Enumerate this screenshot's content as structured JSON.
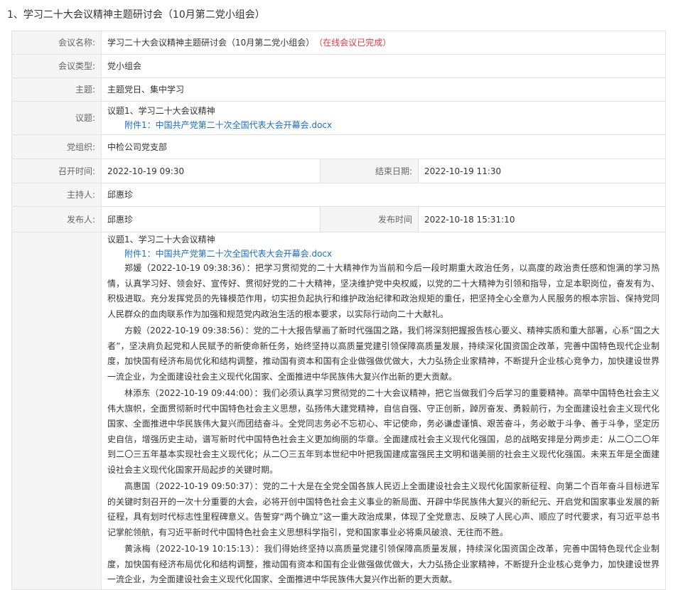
{
  "page": {
    "title": "1、学习二十大会议精神主题研讨会（10月第二党小组会）"
  },
  "fields": {
    "name_label": "会议名称:",
    "name_value": "学习二十大会议精神主题研讨会（10月第二党小组会）",
    "status": "（在线会议已完成）",
    "type_label": "会议类型:",
    "type_value": "党小组会",
    "theme_label": "主题:",
    "theme_value": "主题党日、集中学习",
    "topic_label": "议题:",
    "topic_value": "议题1、学习二十大会议精神",
    "attachment": "附件1：中国共产党第二十次全国代表大会开幕会.docx",
    "org_label": "党组织:",
    "org_value": "中检公司党支部",
    "start_label": "召开时间:",
    "start_value": "2022-10-19 09:30",
    "end_label": "结束日期:",
    "end_value": "2022-10-19 11:30",
    "host_label": "主持人:",
    "host_value": "邱惠珍",
    "publisher_label": "发布人:",
    "publisher_value": "邱惠珍",
    "publish_time_label": "发布时间",
    "publish_time_value": "2022-10-18 15:31:10"
  },
  "content": {
    "topic": "议题1、学习二十大会议精神",
    "attachment": "附件1：中国共产党第二十次全国代表大会开幕会.docx",
    "comments": [
      "郑媛（2022-10-19 09:38:36）：把学习贯彻党的二十大精神作为当前和今后一段时期重大政治任务，以高度的政治责任感和饱满的学习热情，认真学习好、领会好、宣传好、贯彻好党的二十大精神，坚决维护党中央权威，以党的二十大精神为引领和指导，立足本职岗位，奋发有为、积极进取。充分发挥党员的先锋模范作用，切实担负起执行和维护政治纪律和政治规矩的重任，把坚持全心全意为人民服务的根本宗旨、保持党同人民群众的血肉联系作为加强和规范党内政治生活的根本要求，以实际行动向二十大献礼。",
      "方毅（2022-10-19 09:38:56）：党的二十大报告擘画了新时代强国之路，我们将深刻把握报告核心要义、精神实质和重大部署，心系“国之大者”，坚决肩负起党和人民赋予的新使命新任务，始终坚持以高质量党建引领保障高质量发展，持续深化国资国企改革，完善中国特色现代企业制度，加快国有经济布局优化和结构调整，推动国有资本和国有企业做强做优做大，大力弘扬企业家精神，不断提升企业核心竞争力，加快建设世界一流企业，为全面建设社会主义现代化国家、全面推进中华民族伟大复兴作出新的更大贡献。",
      "林添东（2022-10-19 09:44:00）：我们必须认真学习贯彻党的二十大会议精神，把它当做我们今后学习的重要精神。高举中国特色社会主义伟大旗帜，全面贯彻新时代中国特色社会主义思想，弘扬伟大建党精神，自信自强、守正创新，踔厉奋发、勇毅前行，为全面建设社会主义现代化国家、全面推进中华民族伟大复兴而团结奋斗。全党同志务必不忘初心、牢记使命，务必谦虚谨慎、艰苦奋斗，务必敢于斗争、善于斗争，坚定历史自信，增强历史主动，谱写新时代中国特色社会主义更加绚丽的华章。全面建成社会主义现代化强国，总的战略安排是分两步走：从二〇二〇年到二〇三五年基本实现社会主义现代化；从二〇三五年到本世纪中叶把我国建成富强民主文明和谐美丽的社会主义现代化强国。未来五年是全面建设社会主义现代化国家开局起步的关键时期。",
      "高惠国（2022-10-19 09:50:37）：党的二十大是在全党全国各族人民迈上全面建设社会主义现代化国家新征程、向第二个百年奋斗目标进军的关键时刻召开的一次十分重要的大会，必将开创中国特色社会主义事业的新局面、开辟中华民族伟大复兴的新纪元、开启党和国家事业发展的新征程，具有划时代标志性里程碑意义。告誓穿“两个确立”这一重大政治成果，体现了全党意志、反映了人民心声、顺应了时代要求，有习近平总书记掌舵领航，有习近平新时代中国特色社会主义思想科学指引，党和国家事业必将乘风破浪、无往而不胜。",
      "黄泳梅（2022-10-19 10:15:13）：我们得始终坚持以高质量党建引领保障高质量发展，持续深化国资国企改革，完善中国特色现代企业制度，加快国有经济布局优化和结构调整，推动国有资本和国有企业做强做优做大，大力弘扬企业家精神，不断提升企业核心竞争力，加快建设世界一流企业，为全面建设社会主义现代化国家、全面推进中华民族伟大复兴作出新的更大贡献。"
    ]
  }
}
